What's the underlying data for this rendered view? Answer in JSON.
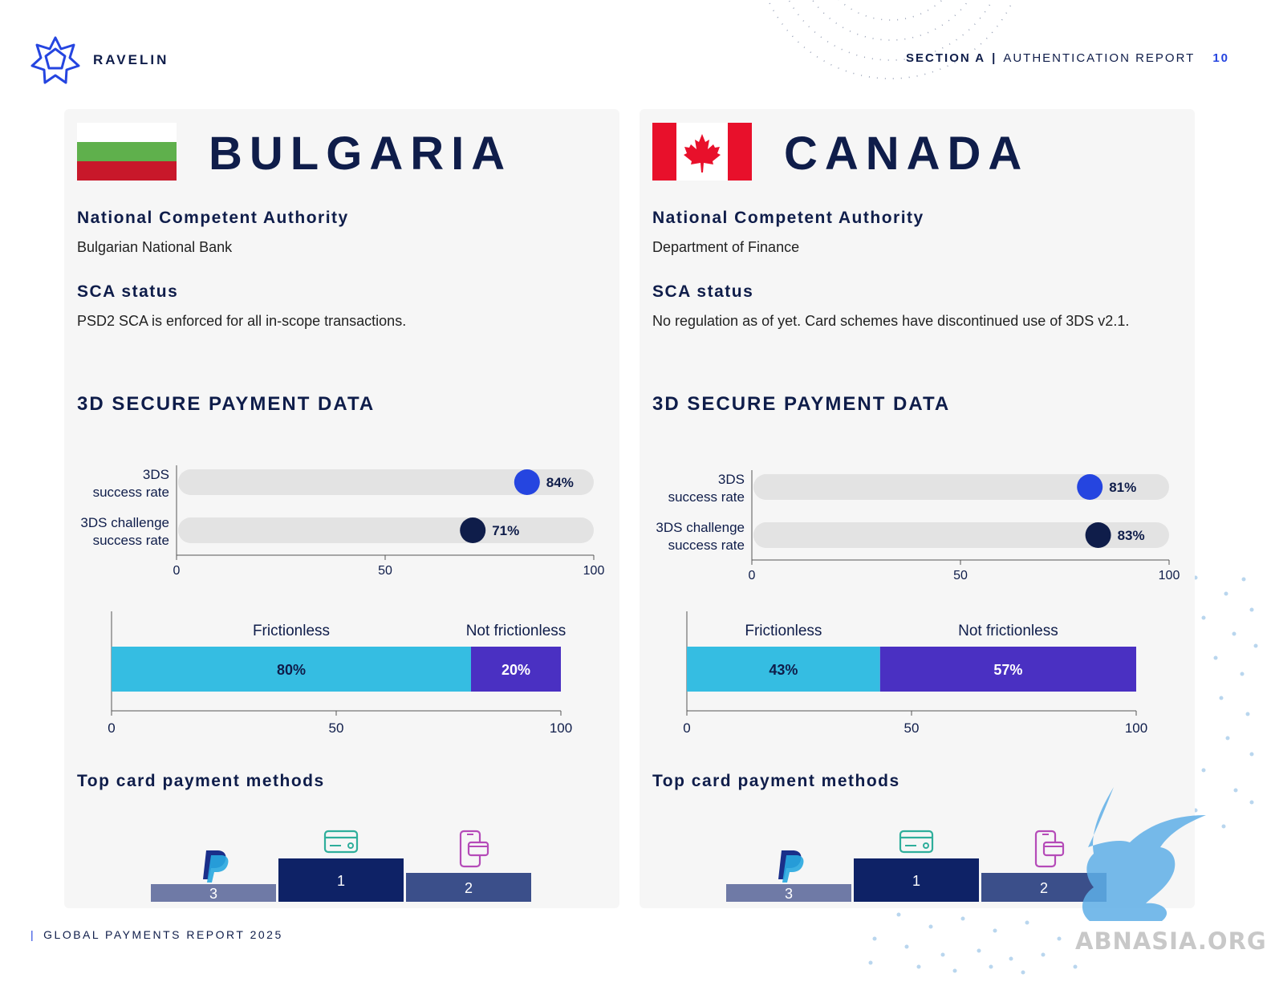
{
  "header": {
    "brand": "RAVELIN",
    "section": "SECTION A",
    "separator": "|",
    "report": "AUTHENTICATION REPORT",
    "page_number": "10"
  },
  "footer": {
    "bar": "|",
    "text": "GLOBAL PAYMENTS REPORT 2025"
  },
  "colors": {
    "navy": "#0f1d4a",
    "accent_blue": "#2545e0",
    "frictionless": "#35bde2",
    "not_frictionless": "#4a30c2",
    "podium_1": "#0e2266",
    "podium_2": "#3b4f8a",
    "podium_3": "#6f7aa6"
  },
  "left": {
    "country": "BULGARIA",
    "authority_heading": "National Competent Authority",
    "authority_text": "Bulgarian National Bank",
    "sca_heading": "SCA status",
    "sca_text": "PSD2 SCA is enforced for all in-scope transactions.",
    "data_heading": "3D SECURE PAYMENT DATA",
    "top_methods_heading": "Top card payment methods",
    "podium": [
      "3",
      "1",
      "2"
    ],
    "podium_icons": [
      "paypal-icon",
      "credit-card-icon",
      "mobile-wallet-icon"
    ]
  },
  "right": {
    "country": "CANADA",
    "authority_heading": "National Competent Authority",
    "authority_text": "Department of Finance",
    "sca_heading": "SCA status",
    "sca_text": "No regulation as of yet. Card schemes have discontinued use of 3DS v2.1.",
    "data_heading": "3D SECURE PAYMENT DATA",
    "top_methods_heading": "Top card payment methods",
    "podium": [
      "3",
      "1",
      "2"
    ],
    "podium_icons": [
      "paypal-icon",
      "credit-card-icon",
      "mobile-wallet-icon"
    ]
  },
  "watermark": "ABNASIA.ORG",
  "chart_data": [
    {
      "type": "bar",
      "country": "BULGARIA",
      "orientation": "horizontal",
      "categories": [
        "3DS\nsuccess rate",
        "3DS challenge\nsuccess rate"
      ],
      "values": [
        84,
        71
      ],
      "labels": [
        "84%",
        "71%"
      ],
      "xlim": [
        0,
        100
      ],
      "ticks": [
        "0",
        "50",
        "100"
      ]
    },
    {
      "type": "bar",
      "country": "BULGARIA",
      "orientation": "horizontal-stacked",
      "series": [
        {
          "name": "Frictionless",
          "values": [
            80
          ],
          "label": "80%"
        },
        {
          "name": "Not frictionless",
          "values": [
            20
          ],
          "label": "20%"
        }
      ],
      "xlim": [
        0,
        100
      ],
      "ticks": [
        "0",
        "50",
        "100"
      ]
    },
    {
      "type": "bar",
      "country": "CANADA",
      "orientation": "horizontal",
      "categories": [
        "3DS\nsuccess rate",
        "3DS challenge\nsuccess rate"
      ],
      "values": [
        81,
        83
      ],
      "labels": [
        "81%",
        "83%"
      ],
      "xlim": [
        0,
        100
      ],
      "ticks": [
        "0",
        "50",
        "100"
      ]
    },
    {
      "type": "bar",
      "country": "CANADA",
      "orientation": "horizontal-stacked",
      "series": [
        {
          "name": "Frictionless",
          "values": [
            43
          ],
          "label": "43%"
        },
        {
          "name": "Not frictionless",
          "values": [
            57
          ],
          "label": "57%"
        }
      ],
      "xlim": [
        0,
        100
      ],
      "ticks": [
        "0",
        "50",
        "100"
      ]
    }
  ]
}
